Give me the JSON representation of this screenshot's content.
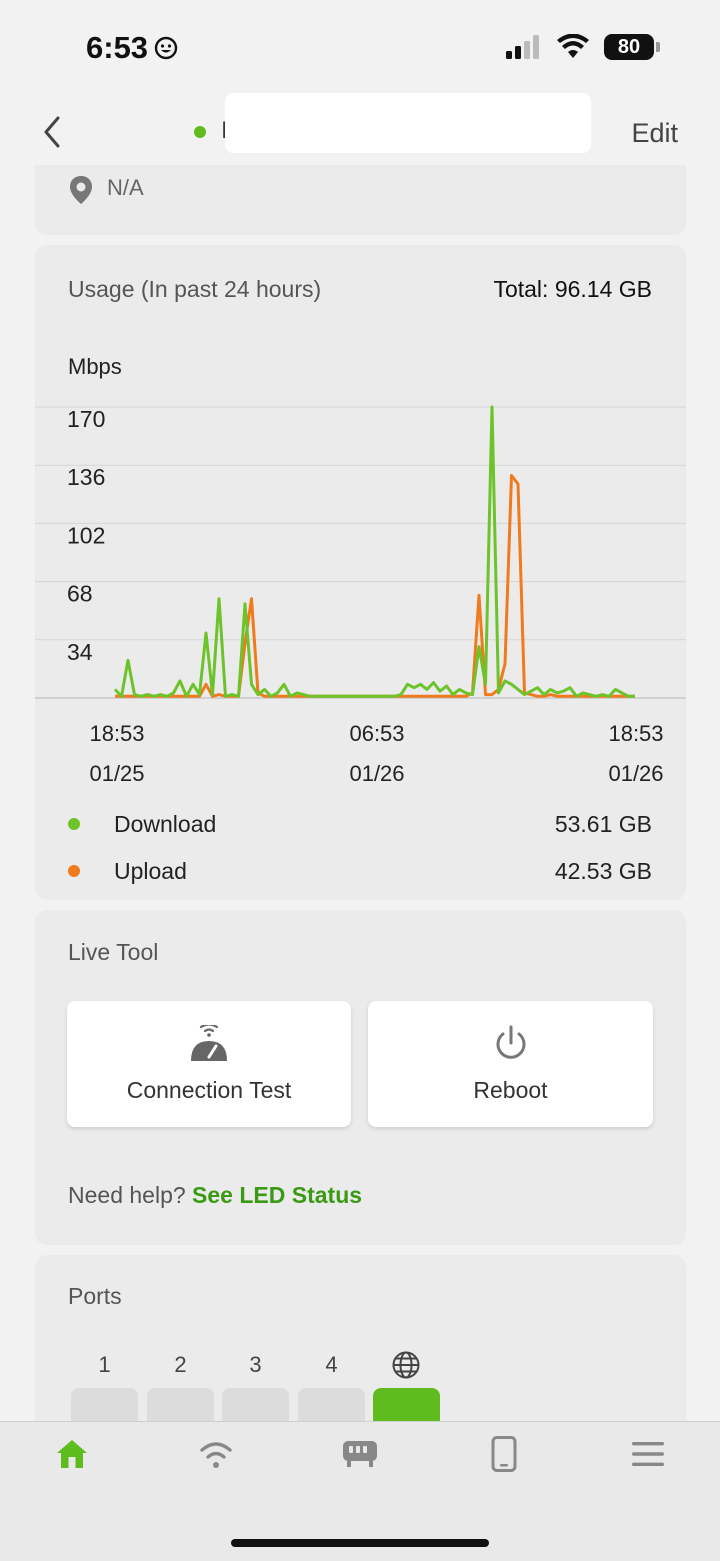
{
  "status_bar": {
    "time": "6:53",
    "battery": "80"
  },
  "header": {
    "device_name": "I",
    "edit_label": "Edit"
  },
  "location": {
    "text": "N/A"
  },
  "usage": {
    "title": "Usage (In past 24 hours)",
    "total": "Total: 96.14 GB",
    "unit": "Mbps",
    "legend": [
      {
        "label": "Download",
        "value": "53.61 GB",
        "color": "#6cc32a"
      },
      {
        "label": "Upload",
        "value": "42.53 GB",
        "color": "#f07a1e"
      }
    ]
  },
  "chart_data": {
    "type": "line",
    "ylabel": "Mbps",
    "ylim": [
      0,
      170
    ],
    "yticks": [
      "170",
      "136",
      "102",
      "68",
      "34"
    ],
    "xticks": [
      {
        "time": "18:53",
        "date": "01/25"
      },
      {
        "time": "06:53",
        "date": "01/26"
      },
      {
        "time": "18:53",
        "date": "01/26"
      }
    ],
    "x": [
      0,
      0.3,
      0.6,
      0.9,
      1.2,
      1.5,
      1.8,
      2.1,
      2.4,
      2.7,
      3.0,
      3.3,
      3.6,
      3.9,
      4.2,
      4.5,
      4.8,
      5.1,
      5.4,
      5.7,
      6.0,
      6.3,
      6.6,
      6.9,
      7.2,
      7.5,
      7.8,
      8.1,
      8.4,
      8.7,
      9.0,
      9.3,
      9.6,
      9.9,
      10.2,
      10.5,
      10.8,
      11.1,
      11.4,
      11.7,
      12.0,
      12.3,
      12.6,
      12.9,
      13.2,
      13.5,
      13.8,
      14.1,
      14.4,
      14.7,
      15.0,
      15.3,
      15.6,
      15.9,
      16.2,
      16.5,
      16.8,
      17.1,
      17.4,
      17.7,
      18.0,
      18.3,
      18.6,
      18.9,
      19.2,
      19.5,
      19.8,
      20.1,
      20.4,
      20.7,
      21.0,
      21.3,
      21.6,
      21.9,
      22.2,
      22.5,
      22.8,
      23.1,
      23.4,
      23.7,
      24.0
    ],
    "series": [
      {
        "name": "Download",
        "color": "#6cc32a",
        "values": [
          5,
          1,
          22,
          2,
          1,
          2,
          1,
          2,
          1,
          3,
          10,
          1,
          8,
          2,
          38,
          2,
          58,
          1,
          2,
          1,
          55,
          8,
          2,
          5,
          1,
          3,
          8,
          1,
          3,
          2,
          1,
          1,
          1,
          1,
          1,
          1,
          1,
          1,
          1,
          1,
          1,
          1,
          1,
          1,
          2,
          8,
          6,
          8,
          5,
          9,
          4,
          7,
          2,
          5,
          3,
          2,
          30,
          8,
          170,
          3,
          10,
          8,
          5,
          2,
          4,
          6,
          2,
          5,
          3,
          4,
          6,
          1,
          3,
          2,
          1,
          2,
          1,
          5,
          3,
          1,
          1
        ]
      },
      {
        "name": "Upload",
        "color": "#f07a1e",
        "values": [
          1,
          1,
          1,
          1,
          1,
          1,
          1,
          1,
          1,
          1,
          1,
          1,
          1,
          1,
          8,
          1,
          2,
          1,
          1,
          1,
          32,
          58,
          3,
          1,
          1,
          1,
          1,
          1,
          1,
          1,
          1,
          1,
          1,
          1,
          1,
          1,
          1,
          1,
          1,
          1,
          1,
          1,
          1,
          1,
          1,
          1,
          1,
          1,
          1,
          1,
          1,
          1,
          1,
          1,
          1,
          3,
          60,
          2,
          2,
          5,
          20,
          130,
          125,
          3,
          2,
          1,
          1,
          2,
          1,
          1,
          1,
          1,
          1,
          1,
          1,
          1,
          1,
          1,
          1,
          1,
          1
        ]
      }
    ]
  },
  "live_tool": {
    "title": "Live Tool",
    "connection_test": "Connection Test",
    "reboot": "Reboot",
    "help_prefix": "Need help?",
    "help_link": "See LED Status"
  },
  "ports": {
    "title": "Ports",
    "labels": [
      "1",
      "2",
      "3",
      "4"
    ],
    "wan_icon": "globe-icon"
  },
  "tabbar": {
    "icons": [
      "home-icon",
      "wifi-icon",
      "router-icon",
      "phone-icon",
      "menu-icon"
    ],
    "active_color": "#5ebc1e"
  }
}
